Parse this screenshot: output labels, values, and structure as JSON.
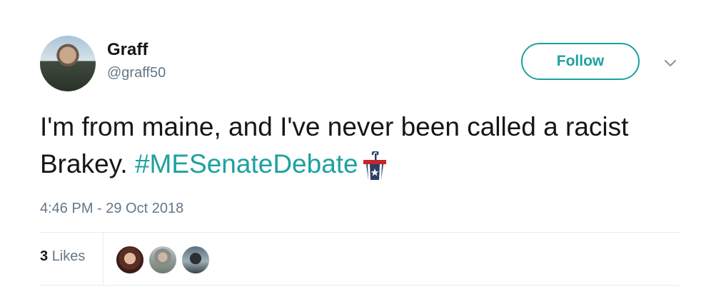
{
  "user": {
    "display_name": "Graff",
    "handle": "@graff50"
  },
  "actions": {
    "follow_label": "Follow"
  },
  "tweet": {
    "text_prefix": "I'm from maine, and I've never been called a racist Brakey.  ",
    "hashtag": "#MESenateDebate",
    "hashtag_emoji": "podium-icon",
    "timestamp": "4:46 PM - 29 Oct 2018"
  },
  "stats": {
    "likes_count": "3",
    "likes_label": "Likes"
  },
  "colors": {
    "accent": "#1da1a0",
    "muted_text": "#657786",
    "text": "#14171a",
    "divider": "#e6ecf0"
  }
}
